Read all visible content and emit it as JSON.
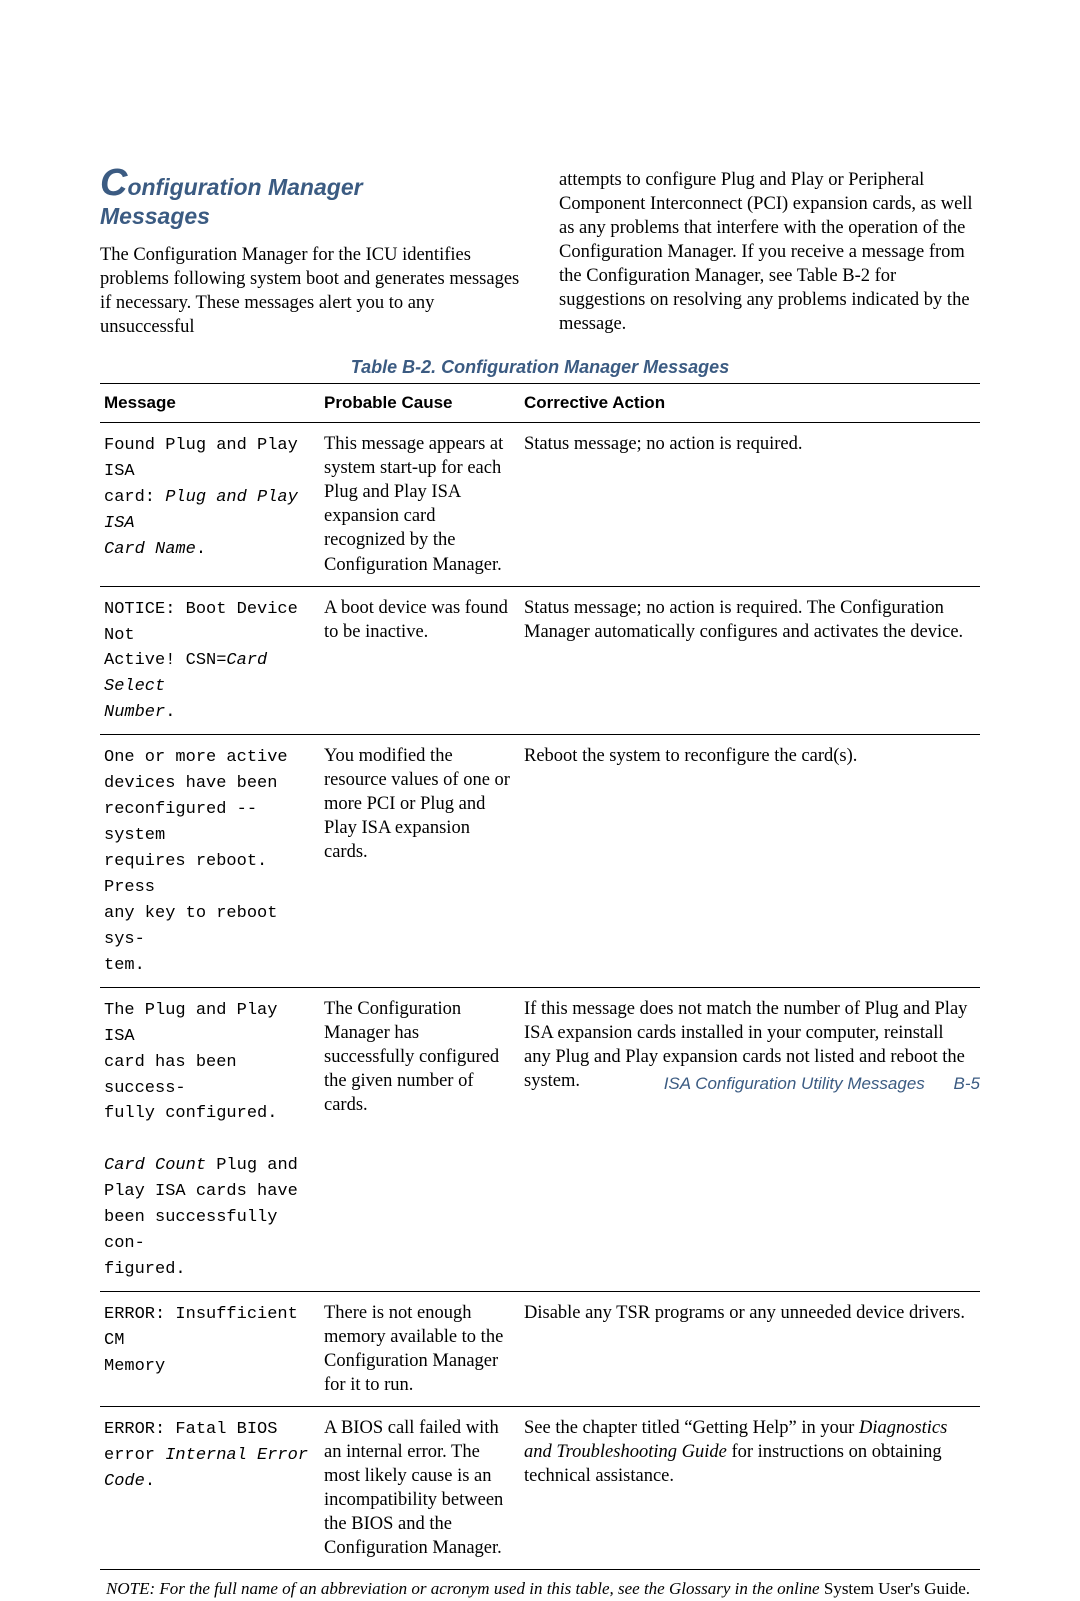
{
  "heading": {
    "dropcap": "C",
    "rest_line1": "onfiguration Manager",
    "line2": "Messages"
  },
  "intro": {
    "left": "The Configuration Manager for the ICU identifies problems following system boot and generates messages if necessary. These messages alert you to any unsuccessful",
    "right": "attempts to configure Plug and Play or Peripheral Component Interconnect (PCI) expansion cards, as well as any problems that interfere with the operation of the Configuration Manager. If you receive a message from the Configuration Manager, see Table B-2 for suggestions on resolving any problems indicated by the message."
  },
  "table": {
    "caption": "Table B-2.  Configuration Manager Messages",
    "headers": {
      "message": "Message",
      "cause": "Probable Cause",
      "action": "Corrective Action"
    },
    "rows": [
      {
        "msg_pre": "Found Plug and Play ISA\ncard: ",
        "msg_ital": "Plug and Play ISA\nCard Name",
        "msg_post": ".",
        "cause": "This message appears at system start-up for each Plug and Play ISA expansion card recognized by the Configuration Manager.",
        "action": "Status message; no action is required."
      },
      {
        "msg_pre": "NOTICE: Boot Device Not\nActive! CSN=",
        "msg_ital": "Card Select\nNumber",
        "msg_post": ".",
        "cause": "A boot device was found to be inactive.",
        "action": "Status message; no action is required. The Configuration Manager automatically configures and activates the device."
      },
      {
        "msg_pre": "One or more active\ndevices have been\nreconfigured -- system\nrequires reboot. Press\nany key to reboot sys-\ntem.",
        "msg_ital": "",
        "msg_post": "",
        "cause": "You modified the resource values of one or more PCI or Plug and Play ISA expansion cards.",
        "action": "Reboot the system to reconfigure the card(s)."
      },
      {
        "msg_pre": "The Plug and Play ISA\ncard has been success-\nfully configured.\n\n",
        "msg_ital": "Card Count",
        "msg_post": " Plug and\nPlay ISA cards have\nbeen successfully con-\nfigured.",
        "cause": "The Configuration Manager has successfully configured the given number of cards.",
        "action": "If this message does not match the number of Plug and Play ISA expansion cards installed in your computer, reinstall any Plug and Play expansion cards not listed and reboot the system."
      },
      {
        "msg_pre": "ERROR: Insufficient CM\nMemory",
        "msg_ital": "",
        "msg_post": "",
        "cause": "There is not enough memory available to the Configuration Manager for it to run.",
        "action": "Disable any TSR programs or any unneeded device drivers."
      },
      {
        "msg_pre": "ERROR: Fatal BIOS\nerror ",
        "msg_ital": "Internal Error\nCode",
        "msg_post": ".",
        "cause": "A BIOS call failed with an internal error. The most likely cause is an incompatibility between the BIOS and the Configuration Manager.",
        "action_pre": "See the chapter titled “Getting Help” in your ",
        "action_ital": "Diagnostics and Troubleshooting Guide",
        "action_post": " for instructions on obtaining technical assistance."
      }
    ],
    "note_pre": "NOTE: For the full name of an abbreviation or acronym used in this table, see the Glossary in the online ",
    "note_post": "System User's Guide",
    "note_end": "."
  },
  "footer": {
    "title": "ISA Configuration Utility Messages",
    "page": "B-5"
  }
}
